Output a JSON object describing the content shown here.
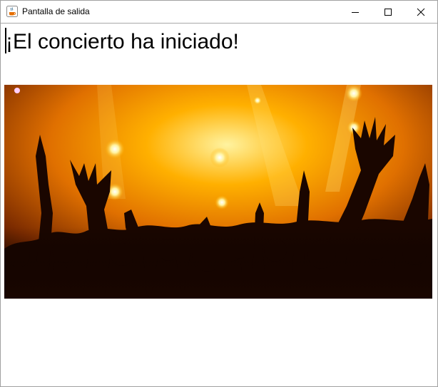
{
  "window": {
    "title": "Pantalla de salida",
    "icon": "java-coffee-icon",
    "controls": {
      "minimize_icon": "minimize-icon",
      "maximize_icon": "maximize-icon",
      "close_icon": "close-icon"
    }
  },
  "content": {
    "heading": "¡El concierto ha iniciado!",
    "image": {
      "subject": "concert crowd with raised hands under stage lights",
      "colors": {
        "light": "#fff3a0",
        "glow": "#ffb000",
        "mid": "#e07000",
        "dark": "#3a1200",
        "silhouette": "#1a0600"
      }
    }
  }
}
